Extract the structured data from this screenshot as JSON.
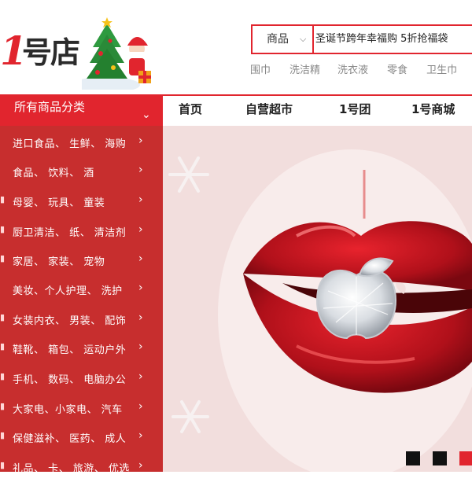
{
  "logo": {
    "one": "1",
    "text": "号店",
    "icon": "christmas-tree-santa-icon"
  },
  "search": {
    "category": "商品",
    "query": "圣诞节跨年幸福购 5折抢福袋"
  },
  "hot_words": [
    "围巾",
    "洗洁精",
    "洗衣液",
    "零食",
    "卫生巾"
  ],
  "category_header": {
    "label": "所有商品分类"
  },
  "nav": [
    "首页",
    "自营超市",
    "1号团",
    "1号商城"
  ],
  "categories": [
    "进口食品、 生鲜、 海购",
    "食品、 饮料、 酒",
    "母婴、 玩具、 童装",
    "厨卫清洁、 纸、 清洁剂",
    "家居、 家装、 宠物",
    "美妆、个人护理、 洗护",
    "女装内衣、 男装、 配饰",
    "鞋靴、 箱包、 运动户外",
    "手机、 数码、 电脑办公",
    "大家电、小家电、 汽车",
    "保健滋补、 医药、 成人",
    "礼品、 卡、 旅游、 优选"
  ],
  "banner": {
    "image": "red-lips-diamond-apple-image"
  },
  "carousel": {
    "active_index": 2,
    "count": 3
  },
  "colors": {
    "brand_red": "#e1252e",
    "sidebar_red": "#c72e2e",
    "banner_bg": "#f2dedd"
  }
}
